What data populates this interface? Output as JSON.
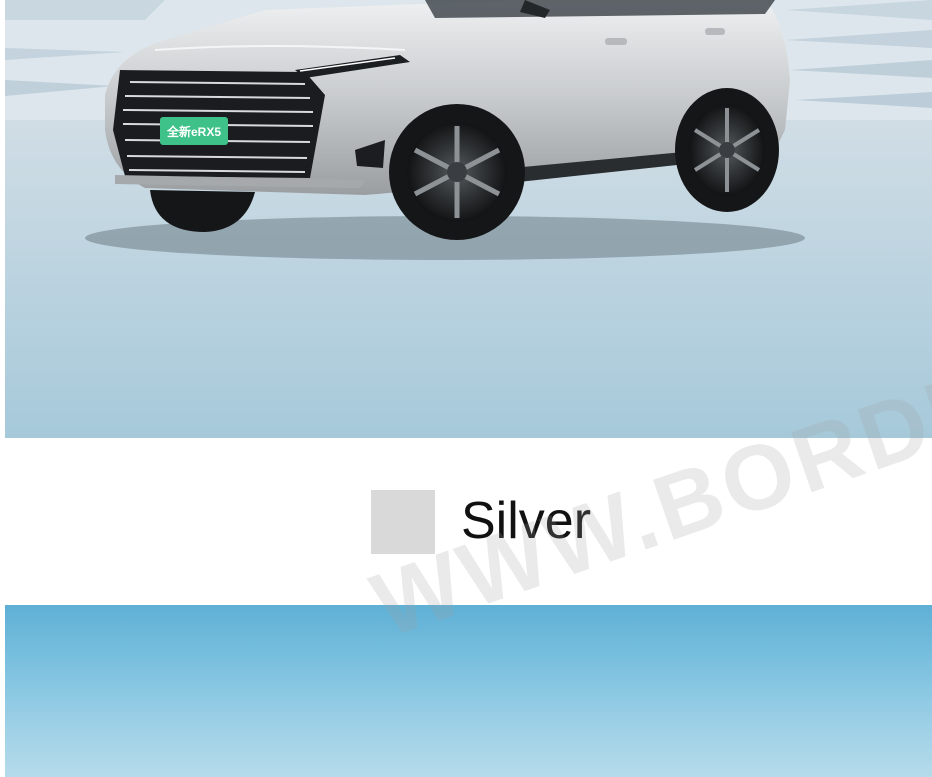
{
  "colors": {
    "swatch": "#d9d9d9",
    "label_text": "#111111",
    "car_body": "#c9ccce",
    "grille_badge": "#3fc18a"
  },
  "top_image": {
    "badge_text": "全新eRX5"
  },
  "color_option": {
    "name": "Silver"
  },
  "watermark": {
    "text": "WWW.BORDER"
  }
}
